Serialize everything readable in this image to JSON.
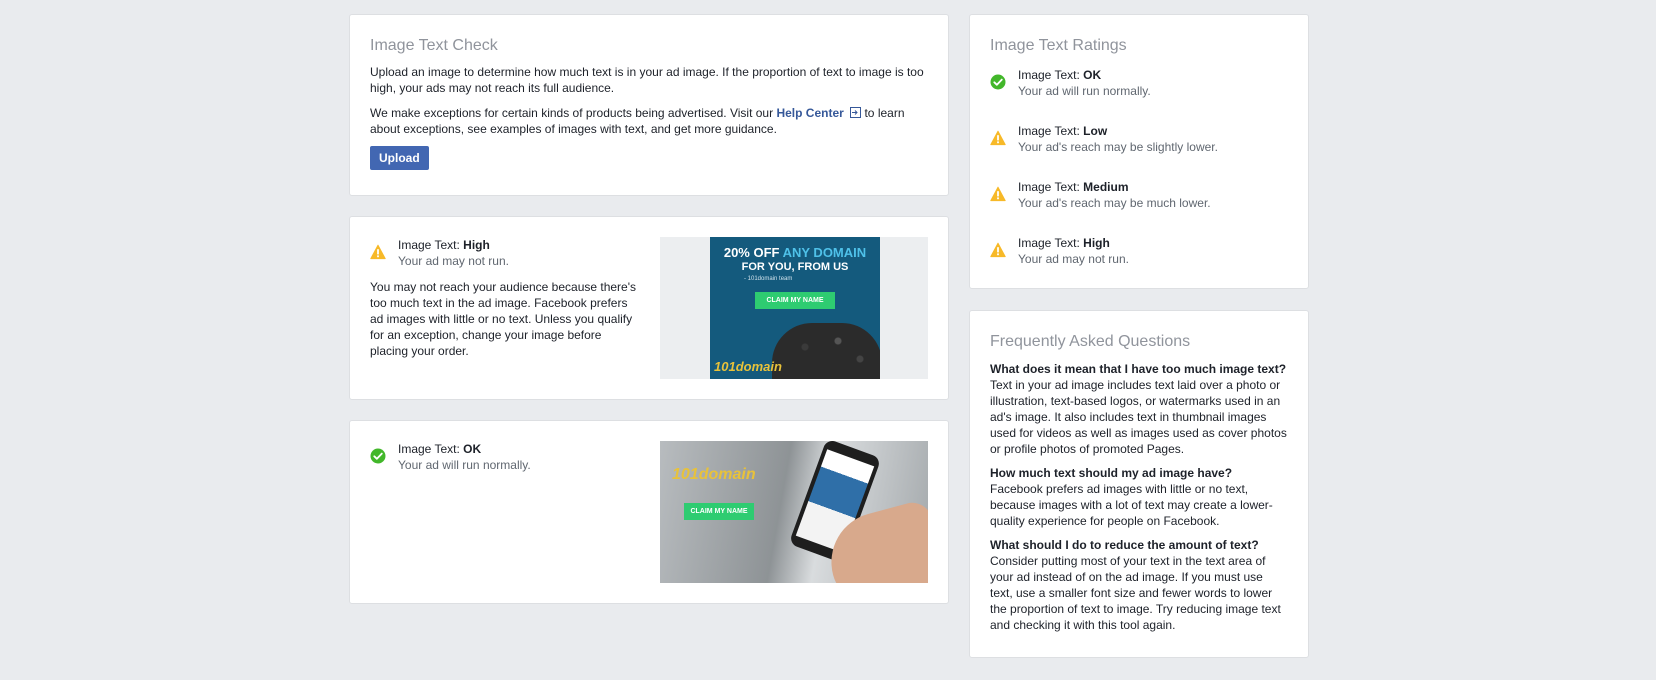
{
  "check": {
    "title": "Image Text Check",
    "intro": "Upload an image to determine how much text is in your ad image. If the proportion of text to image is too high, your ads may not reach its full audience.",
    "exceptions_before": "We make exceptions for certain kinds of products being advertised. Visit our ",
    "help_link": "Help Center",
    "exceptions_after": " to learn about exceptions, see examples of images with text, and get more guidance.",
    "upload_label": "Upload"
  },
  "result_high": {
    "prefix": "Image Text: ",
    "level": "High",
    "sub": "Your ad may not run.",
    "detail": "You may not reach your audience because there's too much text in the ad image. Facebook prefers ad images with little or no text. Unless you qualify for an exception, change your image before placing your order.",
    "ad": {
      "line1_a": "20% OFF ",
      "line1_b": "ANY DOMAIN",
      "line2": "FOR YOU, FROM US",
      "line3": "- 101domain team",
      "cta": "CLAIM MY NAME",
      "logo": "101domain"
    }
  },
  "result_ok": {
    "prefix": "Image Text: ",
    "level": "OK",
    "sub": "Your ad will run normally.",
    "ad": {
      "logo": "101domain",
      "cta": "CLAIM MY NAME"
    }
  },
  "ratings": {
    "title": "Image Text Ratings",
    "items": [
      {
        "prefix": "Image Text: ",
        "level": "OK",
        "sub": "Your ad will run normally.",
        "icon": "check-circle-icon"
      },
      {
        "prefix": "Image Text: ",
        "level": "Low",
        "sub": "Your ad's reach may be slightly lower.",
        "icon": "warning-icon"
      },
      {
        "prefix": "Image Text: ",
        "level": "Medium",
        "sub": "Your ad's reach may be much lower.",
        "icon": "warning-icon"
      },
      {
        "prefix": "Image Text: ",
        "level": "High",
        "sub": "Your ad may not run.",
        "icon": "warning-icon"
      }
    ]
  },
  "faq": {
    "title": "Frequently Asked Questions",
    "items": [
      {
        "q": "What does it mean that I have too much image text?",
        "a": "Text in your ad image includes text laid over a photo or illustration, text-based logos, or watermarks used in an ad's image. It also includes text in thumbnail images used for videos as well as images used as cover photos or profile photos of promoted Pages."
      },
      {
        "q": "How much text should my ad image have?",
        "a": "Facebook prefers ad images with little or no text, because images with a lot of text may create a lower-quality experience for people on Facebook."
      },
      {
        "q": "What should I do to reduce the amount of text?",
        "a": "Consider putting most of your text in the text area of your ad instead of on the ad image. If you must use text, use a smaller font size and fewer words to lower the proportion of text to image. Try reducing image text and checking it with this tool again."
      }
    ]
  },
  "colors": {
    "accent": "#4267b2",
    "link": "#365899",
    "ok": "#42b72a",
    "warning": "#f7b928",
    "background": "#e9ebee"
  }
}
